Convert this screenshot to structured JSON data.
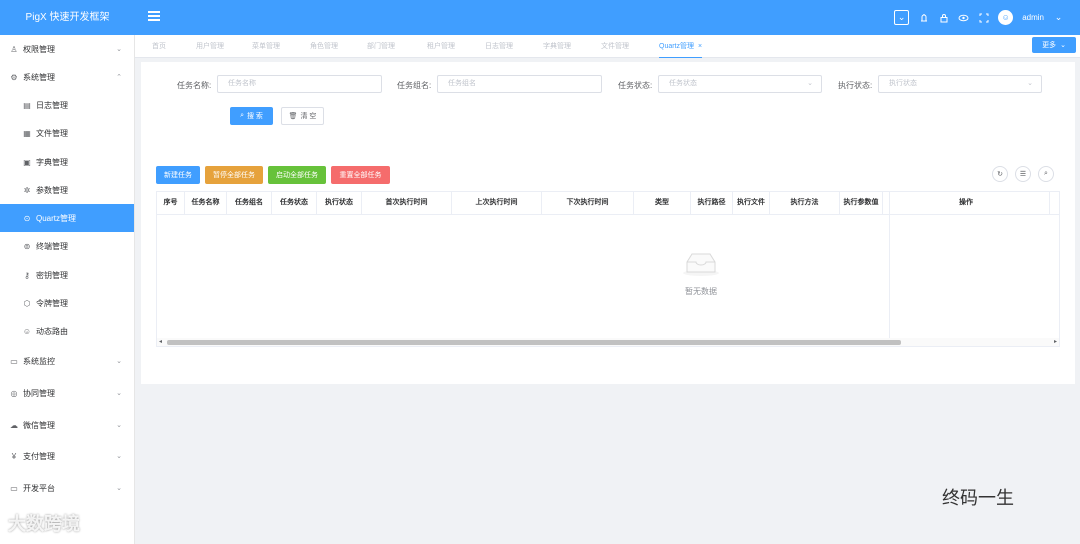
{
  "app": {
    "title": "PigX 快速开发框架"
  },
  "header": {
    "user": "admin"
  },
  "sidebar": {
    "items": [
      {
        "label": "权限管理",
        "icon": "user-icon",
        "glyph": "♙",
        "arrow": "⌄"
      },
      {
        "label": "系统管理",
        "icon": "gear-icon",
        "glyph": "⚙",
        "arrow": "⌃"
      },
      {
        "label": "日志管理",
        "icon": "document-icon",
        "glyph": "▤"
      },
      {
        "label": "文件管理",
        "icon": "grid-icon",
        "glyph": "▦"
      },
      {
        "label": "字典管理",
        "icon": "dictionary-icon",
        "glyph": "▣"
      },
      {
        "label": "参数管理",
        "icon": "settings-icon",
        "glyph": "✲"
      },
      {
        "label": "Quartz管理",
        "icon": "play-circle-icon",
        "glyph": "⊙"
      },
      {
        "label": "终端管理",
        "icon": "terminal-icon",
        "glyph": "⊚"
      },
      {
        "label": "密钥管理",
        "icon": "key-icon",
        "glyph": "⚷"
      },
      {
        "label": "令牌管理",
        "icon": "token-icon",
        "glyph": "⬡"
      },
      {
        "label": "动态路由",
        "icon": "route-icon",
        "glyph": "☺"
      },
      {
        "label": "系统监控",
        "icon": "monitor-icon",
        "glyph": "▭",
        "arrow": "⌄"
      },
      {
        "label": "协同管理",
        "icon": "collaboration-icon",
        "glyph": "◎",
        "arrow": "⌄"
      },
      {
        "label": "微信管理",
        "icon": "wechat-icon",
        "glyph": "☁",
        "arrow": "⌄"
      },
      {
        "label": "支付管理",
        "icon": "pay-icon",
        "glyph": "¥",
        "arrow": "⌄"
      },
      {
        "label": "开发平台",
        "icon": "dev-platform-icon",
        "glyph": "▭",
        "arrow": "⌄"
      }
    ]
  },
  "tabs": [
    "首页",
    "用户管理",
    "菜单管理",
    "角色管理",
    "部门管理",
    "租户管理",
    "日志管理",
    "字典管理",
    "文件管理",
    "Quartz管理"
  ],
  "tab_close": "×",
  "more_label": "更多",
  "search": {
    "job_name_label": "任务名称:",
    "job_name_placeholder": "任务名称",
    "job_group_label": "任务组名:",
    "job_group_placeholder": "任务组名",
    "job_status_label": "任务状态:",
    "job_status_placeholder": "任务状态",
    "exec_status_label": "执行状态:",
    "exec_status_placeholder": "执行状态",
    "search_btn": "搜 索",
    "clear_btn": "清 空"
  },
  "actions": {
    "new": "新建任务",
    "pause_all": "暂停全部任务",
    "start_all": "启动全部任务",
    "reset_all": "重置全部任务"
  },
  "table": {
    "columns": [
      "序号",
      "任务名称",
      "任务组名",
      "任务状态",
      "执行状态",
      "首次执行时间",
      "上次执行时间",
      "下次执行时间",
      "类型",
      "执行路径",
      "执行文件",
      "执行方法",
      "执行参数值",
      "操作"
    ],
    "empty_text": "暂无数据",
    "scroll_left": "◂",
    "scroll_right": "▸"
  },
  "watermarks": {
    "left": "大数跨境",
    "right": "终码一生"
  },
  "colors": {
    "primary": "#409eff",
    "warning": "#e6a23c",
    "success": "#67c23a",
    "danger": "#f56c6c"
  }
}
